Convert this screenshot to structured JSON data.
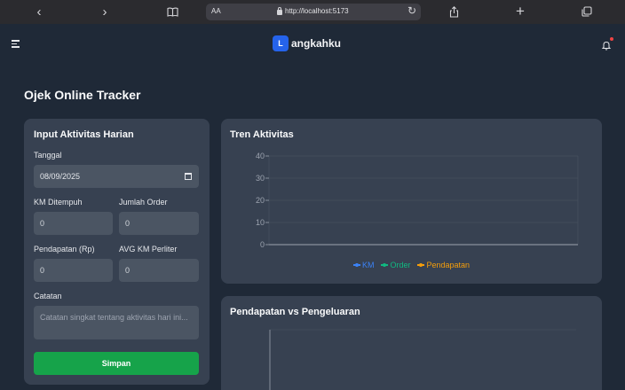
{
  "browser": {
    "text_size_label": "AA",
    "url": "http://localhost:5173"
  },
  "app": {
    "logo_letter": "L",
    "logo_text": "angkahku"
  },
  "page": {
    "title": "Ojek Online Tracker"
  },
  "form": {
    "title": "Input Aktivitas Harian",
    "date_label": "Tanggal",
    "date_value": "08/09/2025",
    "km_label": "KM Ditempuh",
    "km_value": "0",
    "orders_label": "Jumlah Order",
    "orders_value": "0",
    "income_label": "Pendapatan (Rp)",
    "income_value": "0",
    "avg_km_label": "AVG KM Perliter",
    "avg_km_value": "0",
    "notes_label": "Catatan",
    "notes_placeholder": "Catatan singkat tentang aktivitas hari ini...",
    "save_label": "Simpan"
  },
  "trend_card": {
    "title": "Tren Aktivitas"
  },
  "income_expense_card": {
    "title": "Pendapatan vs Pengeluaran"
  },
  "chart_data": [
    {
      "type": "line",
      "title": "Tren Aktivitas",
      "x": [],
      "ylim": [
        0,
        40
      ],
      "yticks": [
        "0",
        "10",
        "20",
        "30",
        "40"
      ],
      "grid": true,
      "legend_position": "bottom",
      "series": [
        {
          "name": "KM",
          "color": "#3b82f6",
          "values": []
        },
        {
          "name": "Order",
          "color": "#10b981",
          "values": []
        },
        {
          "name": "Pendapatan",
          "color": "#f59e0b",
          "values": []
        }
      ]
    },
    {
      "type": "line",
      "title": "Pendapatan vs Pengeluaran",
      "x": [],
      "series": []
    }
  ]
}
